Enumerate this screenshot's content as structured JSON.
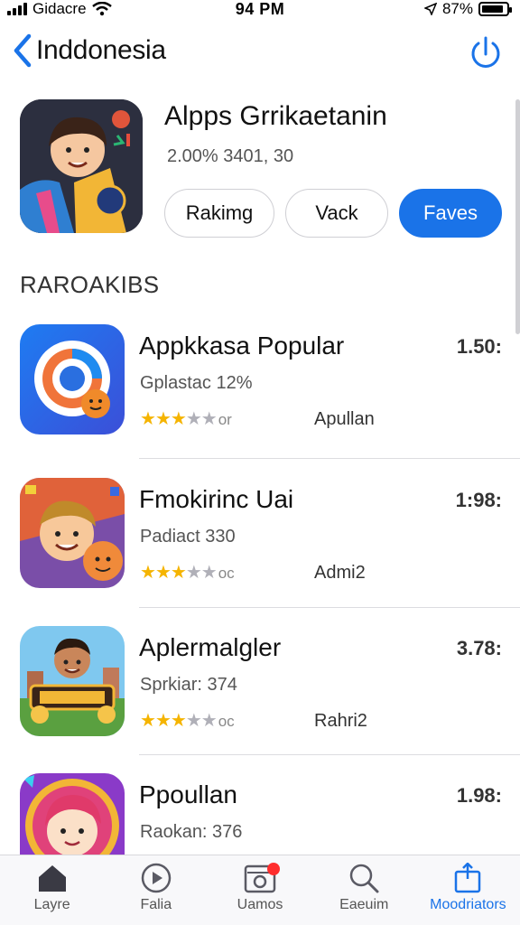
{
  "status_bar": {
    "carrier": "Gidacre",
    "time": "94 PM",
    "battery": "87%",
    "battery_level": 0.87
  },
  "nav": {
    "back_label": "Inddonesia",
    "back_icon": "chevron-left-icon",
    "action_icon": "power-icon"
  },
  "featured": {
    "title": "Alpps Grrikaetanin",
    "stats": "2.00% 3401, 30",
    "buttons": [
      "Rakimg",
      "Vack",
      "Faves"
    ]
  },
  "section": {
    "title": "RAROAKIBS"
  },
  "apps": [
    {
      "name": "Appkkasa Popular",
      "subtitle": "Gplastac 12%",
      "rating": 3.5,
      "rating_tail": "or",
      "tag": "Apullan",
      "price": "1.50:"
    },
    {
      "name": "Fmokirinc Uai",
      "subtitle": "Padiact 330",
      "rating": 3.5,
      "rating_tail": "oc",
      "tag": "Admi2",
      "price": "1:98:"
    },
    {
      "name": "Aplermalgler",
      "subtitle": "Sprkiar: 374",
      "rating": 3.5,
      "rating_tail": "oc",
      "tag": "Rahri2",
      "price": "3.78:"
    },
    {
      "name": "Ppoullan",
      "subtitle": "Raokan: 376",
      "price": "1.98:"
    }
  ],
  "tabs": [
    {
      "label": "Layre",
      "icon": "home-icon"
    },
    {
      "label": "Falia",
      "icon": "play-icon"
    },
    {
      "label": "Uamos",
      "icon": "camera-icon"
    },
    {
      "label": "Eaeuim",
      "icon": "search-icon"
    },
    {
      "label": "Moodriators",
      "icon": "share-icon"
    }
  ],
  "colors": {
    "accent": "#1a73e8",
    "star": "#f5b400",
    "badge": "#ff2d2d"
  }
}
